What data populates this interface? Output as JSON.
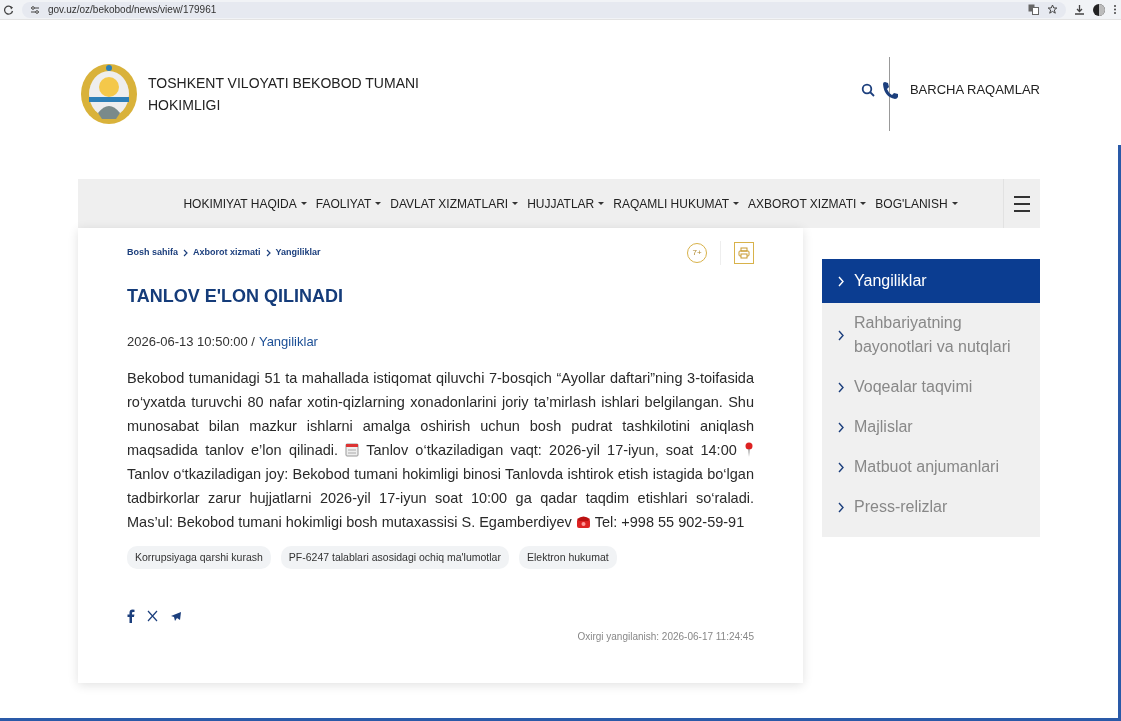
{
  "browser": {
    "url": "gov.uz/oz/bekobod/news/view/179961"
  },
  "header": {
    "title": "TOSHKENT VILOYATI BEKOBOD TUMANI HOKIMLIGI",
    "phone_link": "BARCHA RAQAMLAR"
  },
  "nav": {
    "items": [
      {
        "label": "HOKIMIYAT HAQIDA"
      },
      {
        "label": "FAOLIYAT"
      },
      {
        "label": "DAVLAT XIZMATLARI"
      },
      {
        "label": "HUJJATLAR"
      },
      {
        "label": "RAQAMLI HUKUMAT"
      },
      {
        "label": "AXBOROT XIZMATI"
      },
      {
        "label": "BOG'LANISH"
      }
    ]
  },
  "breadcrumb": [
    "Bosh sahifa",
    "Axborot xizmati",
    "Yangiliklar"
  ],
  "age_badge": "7+",
  "article": {
    "title": "TANLOV E'LON QILINADI",
    "date": "2026-06-13 10:50:00 /",
    "category": "Yangiliklar",
    "body": [
      {
        "kind": "text",
        "text": "Bekobod tumanidagi 51 ta mahallada istiqomat qiluvchi 7-bosqich “Ayollar daftari”ning 3-toifasida ro‘yxatda turuvchi 80 nafar xotin-qizlarning xonadonlarini joriy ta’mirlash ishlari belgilangan. Shu munosabat bilan mazkur ishlarni amalga oshirish uchun bosh pudrat tashkilotini aniqlash maqsadida tanlov e’lon qilinadi."
      },
      {
        "kind": "calendar"
      },
      {
        "kind": "text",
        "text": "Tanlov o‘tkaziladigan vaqt: 2026-yil 17-iyun, soat 14:00"
      },
      {
        "kind": "pin"
      },
      {
        "kind": "text",
        "text": "Tanlov o‘tkaziladigan joy: Bekobod tumani hokimligi binosi Tanlovda ishtirok etish istagida bo‘lgan tadbirkorlar zarur hujjatlarni 2026-yil 17-iyun soat 10:00 ga qadar taqdim etishlari so‘raladi. Mas’ul: Bekobod tumani hokimligi bosh mutaxassisi S. Egamberdiyev"
      },
      {
        "kind": "telephone"
      },
      {
        "kind": "text",
        "text": "Tel: +998 55 902-59-91"
      }
    ],
    "tags": [
      "Korrupsiyaga qarshi kurash",
      "PF-6247 talablari asosidagi ochiq ma'lumotlar",
      "Elektron hukumat"
    ],
    "updated": "Oxirgi yangilanish: 2026-06-17 11:24:45"
  },
  "sidebar": {
    "items": [
      {
        "label": "Yangiliklar",
        "selected": true
      },
      {
        "label": "Rahbariyatning bayonotlari va nutqlari",
        "selected": false
      },
      {
        "label": "Voqealar taqvimi",
        "selected": false
      },
      {
        "label": "Majlislar",
        "selected": false
      },
      {
        "label": "Matbuot anjumanlari",
        "selected": false
      },
      {
        "label": "Press-relizlar",
        "selected": false
      }
    ]
  }
}
